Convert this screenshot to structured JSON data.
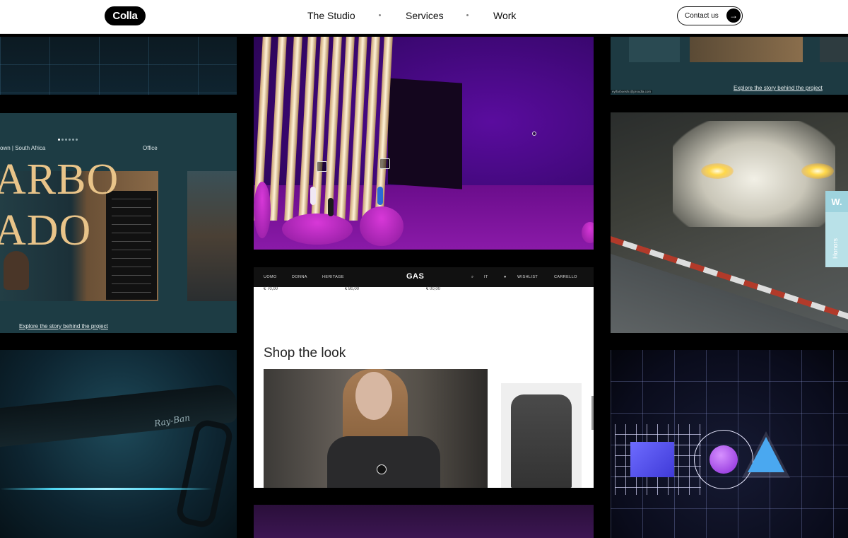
{
  "header": {
    "logo": "Colla",
    "nav": [
      "The Studio",
      "Services",
      "Work"
    ],
    "contact_label": "Contact us",
    "contact_arrow": "→"
  },
  "tiles": {
    "office": {
      "location": "own | South Africa",
      "office_label": "Office",
      "title_line1": "ARBO",
      "title_line2": "ADO",
      "explore": "Explore the story behind the project"
    },
    "top_right": {
      "credit": "ey/farboeshi.@proudla.com",
      "explore": "Explore the story behind the project"
    },
    "eyewear": {
      "brand": "Ray-Ban"
    },
    "gas": {
      "nav_left": [
        "UOMO",
        "DONNA",
        "HERITAGE"
      ],
      "logo": "GAS",
      "nav_right": [
        "IT",
        "WISHLIST",
        "CARRELLO"
      ],
      "prices": [
        "€ 70,00",
        "€ 80,00",
        "€ 00,00"
      ],
      "shop_title": "Shop the look"
    },
    "honors": {
      "badge": "W.",
      "label": "Honors"
    }
  },
  "colors": {
    "accent_gold": "#e9c489",
    "purple_room": "#5a0c9e",
    "honors_badge": "#9ed3de"
  }
}
